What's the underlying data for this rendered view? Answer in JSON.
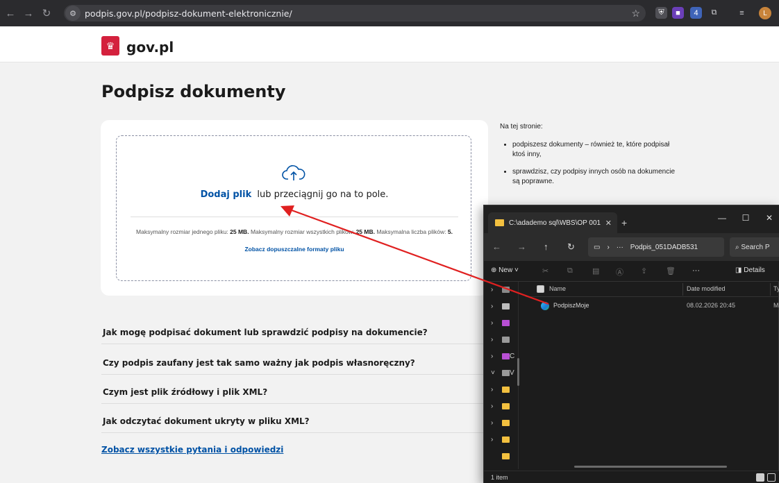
{
  "browser": {
    "url": "podpis.gov.pl/podpisz-dokument-elektronicznie/",
    "back_icon": "arrow-left-icon",
    "forward_icon": "arrow-right-icon",
    "reload_icon": "reload-icon",
    "extension_badge": "4",
    "profile_initial": "L"
  },
  "gov_header": {
    "brand": "gov.pl"
  },
  "page": {
    "title": "Podpisz dokumenty",
    "upload": {
      "add_file": "Dodaj plik",
      "drag_text": "lub przeciągnij go na to pole.",
      "limit_single_label": "Maksymalny rozmiar jednego pliku:",
      "limit_single_value": "25 MB.",
      "limit_total_label": "Maksymalny rozmiar wszystkich plików:",
      "limit_total_value": "25 MB.",
      "limit_count_label": "Maksymalna liczba plików:",
      "limit_count_value": "5.",
      "formats_link": "Zobacz dopuszczalne formaty pliku"
    },
    "side_info": {
      "heading": "Na tej stronie:",
      "items": [
        "podpiszesz dokumenty – również te, które podpisał ktoś inny,",
        "sprawdzisz, czy podpisy innych osób na dokumencie są poprawne."
      ]
    },
    "faq": [
      "Jak mogę podpisać dokument lub sprawdzić podpisy na dokumencie?",
      "Czy podpis zaufany jest tak samo ważny jak podpis własnoręczny?",
      "Czym jest plik źródłowy i plik XML?",
      "Jak odczytać dokument ukryty w pliku XML?"
    ],
    "faq_all_link": "Zobacz wszystkie pytania i odpowiedzi"
  },
  "explorer": {
    "tab_title": "C:\\adademo sql\\WBS\\OP 001",
    "path_sep": "›",
    "path_more": "···",
    "path_current": "Podpis_051DADB531",
    "search_placeholder": "Search P",
    "toolbar": {
      "new_label": "New",
      "more_label": "···",
      "details_label": "Details"
    },
    "columns": {
      "name": "Name",
      "date": "Date modified",
      "type": "Typ"
    },
    "files": [
      {
        "name": "PodpiszMoje",
        "date": "08.02.2026 20:45",
        "type": "Mi"
      }
    ],
    "sidebar_labels": {
      "c_drive": "C",
      "v_drive": "V"
    },
    "status": "1 item",
    "colors": {
      "folder": "#f3c03f",
      "background": "#1c1c1c"
    }
  },
  "annotation": {
    "arrow_color": "#e02020"
  }
}
